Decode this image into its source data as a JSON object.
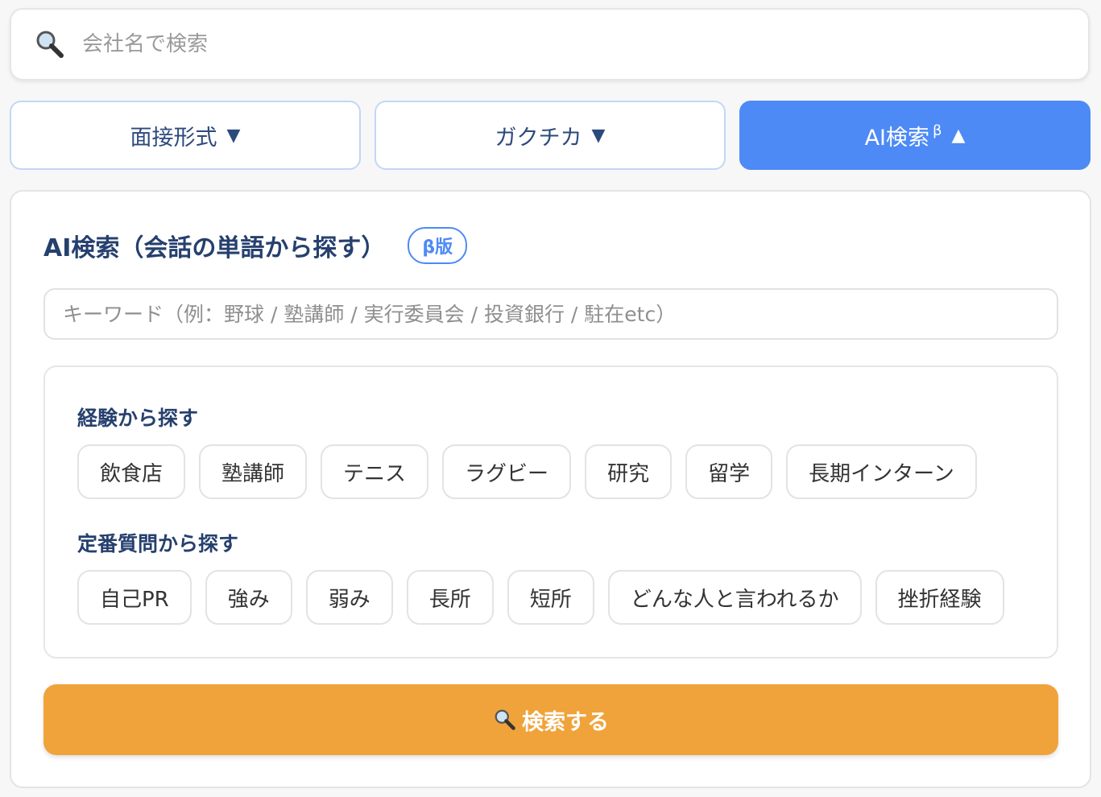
{
  "search": {
    "placeholder": "会社名で検索",
    "icon": "magnifier-icon"
  },
  "tabs": [
    {
      "label": "面接形式",
      "caret": "▼",
      "active": false
    },
    {
      "label": "ガクチカ",
      "caret": "▼",
      "active": false
    },
    {
      "label": "AI検索",
      "superscript": "β",
      "caret": "▲",
      "active": true
    }
  ],
  "ai_search": {
    "title": "AI検索（会話の単語から探す）",
    "badge": "β版",
    "keyword_placeholder": "キーワード（例：野球 / 塾講師 / 実行委員会 / 投資銀行 / 駐在etc）",
    "experience": {
      "title": "経験から探す",
      "chips": [
        "飲食店",
        "塾講師",
        "テニス",
        "ラグビー",
        "研究",
        "留学",
        "長期インターン"
      ]
    },
    "questions": {
      "title": "定番質問から探す",
      "chips": [
        "自己PR",
        "強み",
        "弱み",
        "長所",
        "短所",
        "どんな人と言われるか",
        "挫折経験"
      ]
    },
    "submit_label": "検索する",
    "submit_icon": "magnifier-icon"
  },
  "colors": {
    "accent_blue": "#4d8af5",
    "heading_navy": "#26406e",
    "submit_orange": "#f0a33a"
  }
}
